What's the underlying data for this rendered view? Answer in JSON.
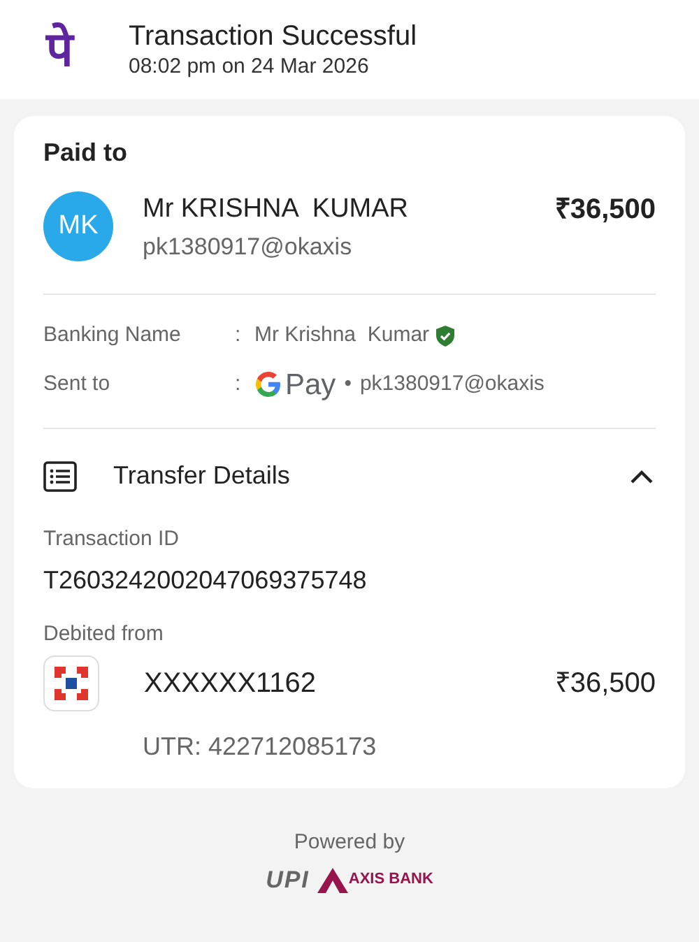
{
  "header": {
    "logo": "पे",
    "title": "Transaction Successful",
    "subtitle": "08:02 pm on 24 Mar 2026"
  },
  "paid_to": {
    "heading": "Paid to",
    "initials": "MK",
    "name": "Mr KRISHNA  KUMAR",
    "upi_id": "pk1380917@okaxis",
    "amount": "₹36,500"
  },
  "details": [
    {
      "label": "Banking Name",
      "separator": ":",
      "kind": "verified_name",
      "value": "Mr Krishna  Kumar",
      "verified": true
    },
    {
      "label": "Sent to",
      "separator": ":",
      "kind": "app",
      "app_text": "Pay",
      "bullet": "•",
      "value": "pk1380917@okaxis"
    }
  ],
  "transfer": {
    "title": "Transfer Details",
    "expanded": true,
    "transaction_id_label": "Transaction ID",
    "transaction_id": "T2603242002047069375748",
    "debited_label": "Debited from",
    "account": "XXXXXX1162",
    "amount": "₹36,500",
    "utr": "UTR: 422712085173"
  },
  "footer": {
    "powered_by": "Powered by",
    "upi": "UPI",
    "bank": "AXIS BANK"
  }
}
